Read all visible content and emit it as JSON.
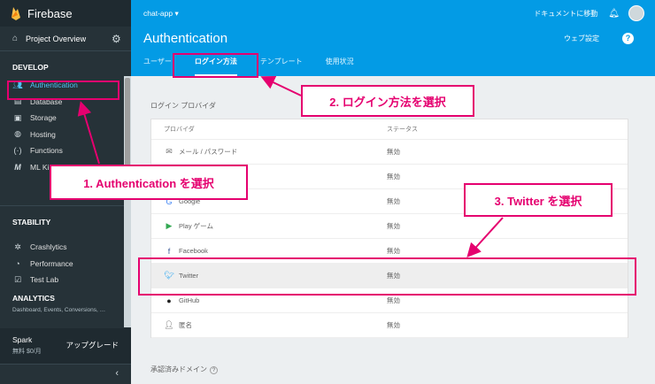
{
  "sidebar": {
    "brand": "Firebase",
    "overview": "Project Overview",
    "develop_title": "DEVELOP",
    "develop_items": [
      {
        "label": "Authentication",
        "icon": "people-icon"
      },
      {
        "label": "Database",
        "icon": "database-icon"
      },
      {
        "label": "Storage",
        "icon": "storage-icon"
      },
      {
        "label": "Hosting",
        "icon": "hosting-icon"
      },
      {
        "label": "Functions",
        "icon": "functions-icon"
      },
      {
        "label": "ML Ki",
        "icon": "ml-icon"
      }
    ],
    "stability_title": "STABILITY",
    "stability_items": [
      {
        "label": "Crashlytics",
        "icon": "crashlytics-icon"
      },
      {
        "label": "Performance",
        "icon": "performance-icon"
      },
      {
        "label": "Test Lab",
        "icon": "testlab-icon"
      }
    ],
    "analytics_title": "ANALYTICS",
    "analytics_sub": "Dashboard, Events, Conversions, …",
    "plan_name": "Spark",
    "plan_price": "無料 $0/月",
    "upgrade": "アップグレード"
  },
  "header": {
    "project": "chat-app ▾",
    "docs": "ドキュメントに移動",
    "title": "Authentication",
    "web_settings": "ウェブ設定",
    "help": "?",
    "tabs": [
      "ユーザー",
      "ログイン方法",
      "テンプレート",
      "使用状況"
    ],
    "active_tab": 1
  },
  "main": {
    "section_label": "ログイン プロバイダ",
    "col_provider": "プロバイダ",
    "col_status": "ステータス",
    "providers": [
      {
        "name": "メール / パスワード",
        "status": "無効",
        "icon": "mail-icon",
        "color": "#757575"
      },
      {
        "name": "",
        "status": "無効",
        "icon": "phone-icon",
        "color": "#757575"
      },
      {
        "name": "Google",
        "status": "無効",
        "icon": "google-icon",
        "color": "#4285f4"
      },
      {
        "name": "Play ゲーム",
        "status": "無効",
        "icon": "play-games-icon",
        "color": "#34a853"
      },
      {
        "name": "Facebook",
        "status": "無効",
        "icon": "facebook-icon",
        "color": "#3b5998"
      },
      {
        "name": "Twitter",
        "status": "無効",
        "icon": "twitter-icon",
        "color": "#1da1f2"
      },
      {
        "name": "GitHub",
        "status": "無効",
        "icon": "github-icon",
        "color": "#212121"
      },
      {
        "name": "匿名",
        "status": "無効",
        "icon": "anonymous-icon",
        "color": "#616161"
      }
    ],
    "approved_domains": "承認済みドメイン"
  },
  "annotations": {
    "step1": "1. Authentication を選択",
    "step2": "2. ログイン方法を選択",
    "step3": "3. Twitter を選択",
    "color": "#e5006f"
  }
}
